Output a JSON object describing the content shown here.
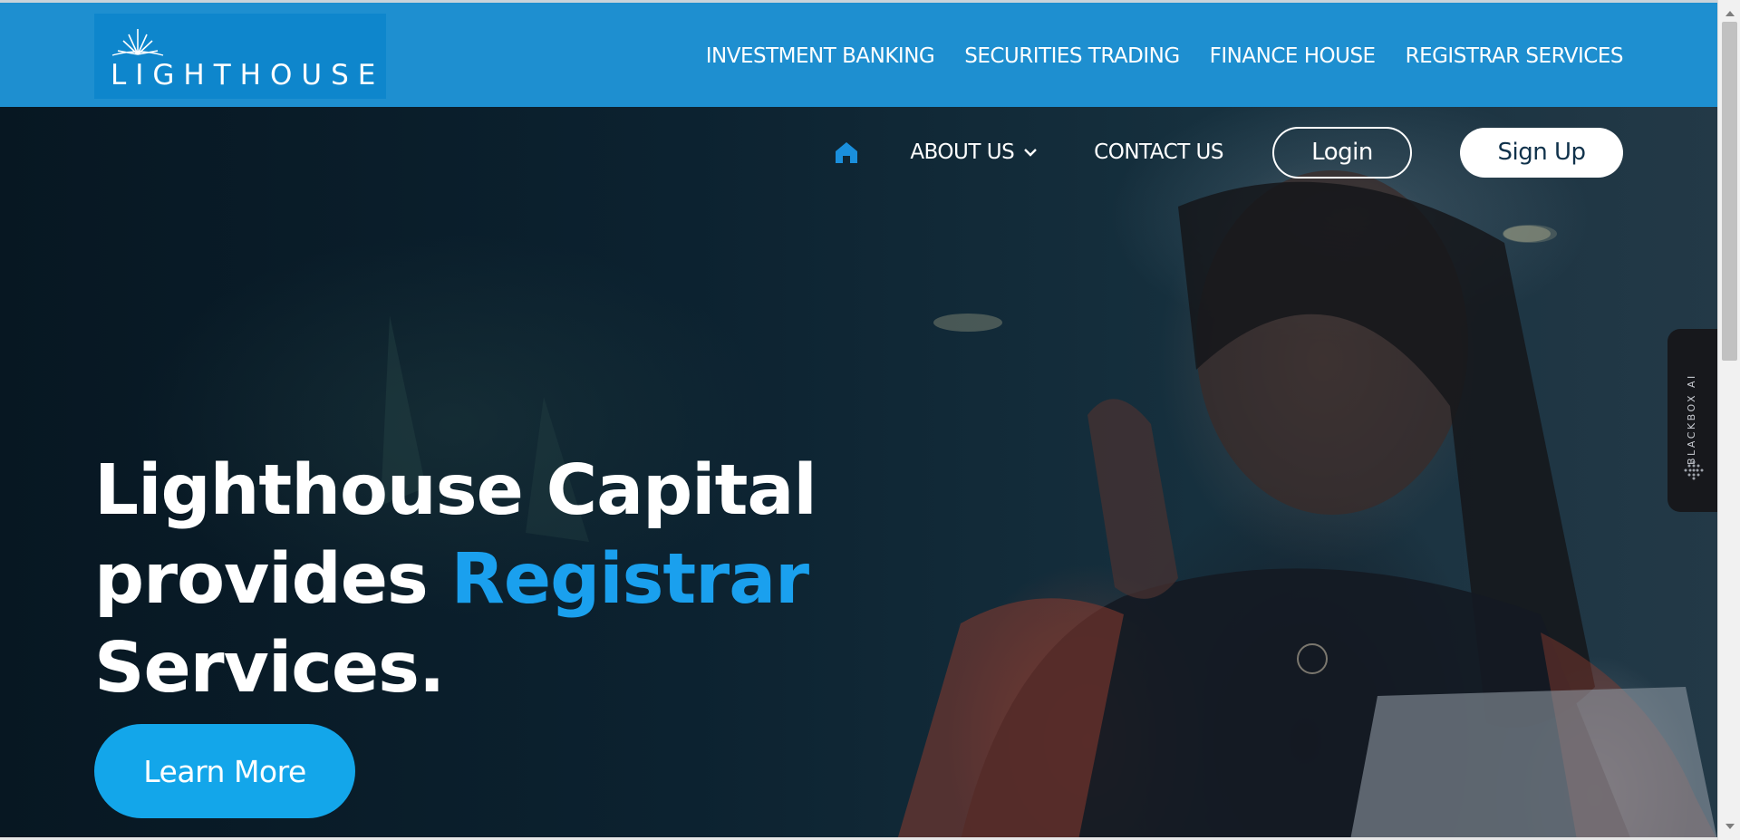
{
  "brand": {
    "logo_text": "LIGHTHOUSE"
  },
  "top_nav": {
    "items": [
      "INVESTMENT BANKING",
      "SECURITIES TRADING",
      "FINANCE HOUSE",
      "REGISTRAR SERVICES"
    ]
  },
  "hero_nav": {
    "home_icon": "home-icon",
    "about_label": "ABOUT US",
    "contact_label": "CONTACT US",
    "login_label": "Login",
    "signup_label": "Sign Up"
  },
  "hero": {
    "line1": "Lighthouse Capital",
    "line2_prefix": "provides",
    "line2_accent": "Registrar",
    "line3": "Services.",
    "cta_label": "Learn More"
  },
  "side_widget": {
    "label": "BLACKBOX AI"
  },
  "colors": {
    "topbar": "#1e8fd0",
    "accent": "#1aa0ee",
    "cta": "#13a6ea",
    "signup_text": "#10324b"
  }
}
